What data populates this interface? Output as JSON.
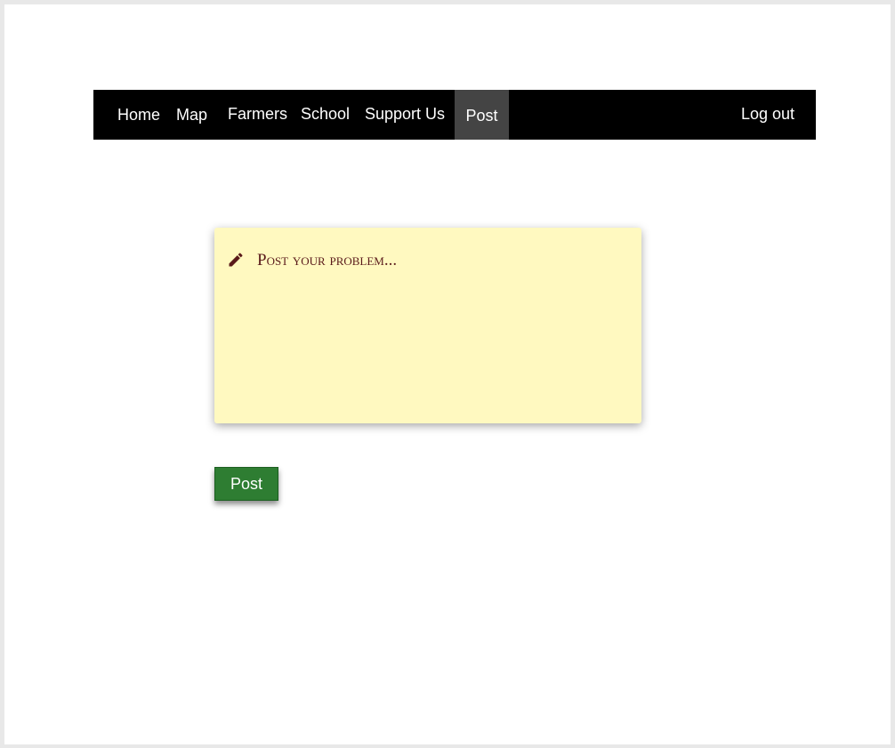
{
  "nav": {
    "items": [
      {
        "label": "Home"
      },
      {
        "label": "Map"
      },
      {
        "label": "Farmers"
      },
      {
        "label": "School"
      },
      {
        "label": "Support Us"
      },
      {
        "label": "Post",
        "active": true
      }
    ],
    "logout_label": "Log out"
  },
  "composer": {
    "placeholder": "Post your problem...",
    "icon": "pencil-icon",
    "background_color": "#fff9c0",
    "text_color": "#5a1a1a"
  },
  "submit": {
    "label": "Post",
    "color": "#2e7d32"
  }
}
